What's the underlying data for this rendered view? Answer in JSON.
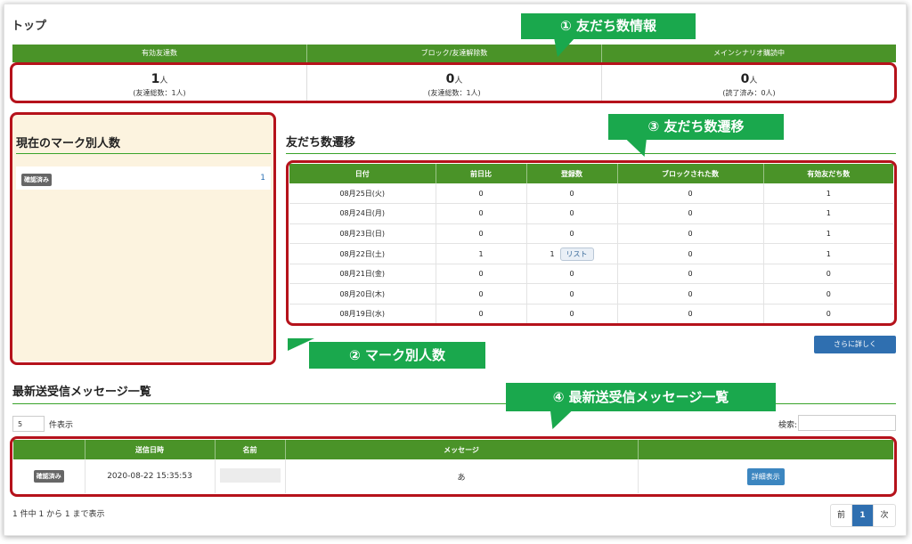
{
  "page": {
    "title": "トップ"
  },
  "stats": {
    "headers": [
      "有効友達数",
      "ブロック/友達解除数",
      "メインシナリオ購読中"
    ],
    "cells": [
      {
        "num": "1",
        "unit": "人",
        "sub": "(友達総数：1人)"
      },
      {
        "num": "0",
        "unit": "人",
        "sub": "(友達総数：1人)"
      },
      {
        "num": "0",
        "unit": "人",
        "sub": "(読了済み：0人)"
      }
    ]
  },
  "callouts": {
    "c1": "① 友だち数情報",
    "c2": "② マーク別人数",
    "c3": "③ 友だち数遷移",
    "c4": "④ 最新送受信メッセージ一覧"
  },
  "marks": {
    "title": "現在のマーク別人数",
    "items": [
      {
        "badge": "確認済み",
        "count": "1"
      }
    ]
  },
  "transition": {
    "title": "友だち数遷移",
    "headers": [
      "日付",
      "前日比",
      "登録数",
      "ブロックされた数",
      "有効友だち数"
    ],
    "list_label": "リスト",
    "rows": [
      [
        "08月25日(火)",
        "0",
        "0",
        "0",
        "1"
      ],
      [
        "08月24日(月)",
        "0",
        "0",
        "0",
        "1"
      ],
      [
        "08月23日(日)",
        "0",
        "0",
        "0",
        "1"
      ],
      [
        "08月22日(土)",
        "1",
        "1",
        "0",
        "1"
      ],
      [
        "08月21日(金)",
        "0",
        "0",
        "0",
        "0"
      ],
      [
        "08月20日(木)",
        "0",
        "0",
        "0",
        "0"
      ],
      [
        "08月19日(水)",
        "0",
        "0",
        "0",
        "0"
      ]
    ],
    "more_label": "さらに詳しく"
  },
  "messages": {
    "title": "最新送受信メッセージ一覧",
    "per_page": "5",
    "per_page_label": "件表示",
    "search_label": "検索:",
    "headers": [
      "",
      "送信日時",
      "名前",
      "メッセージ",
      ""
    ],
    "rows": [
      {
        "badge": "確認済み",
        "date": "2020-08-22 15:35:53",
        "name": "",
        "message": "あ",
        "action": "詳細表示"
      }
    ],
    "info": "1 件中 1 から 1 まで表示",
    "pager": {
      "prev": "前",
      "current": "1",
      "next": "次"
    }
  }
}
